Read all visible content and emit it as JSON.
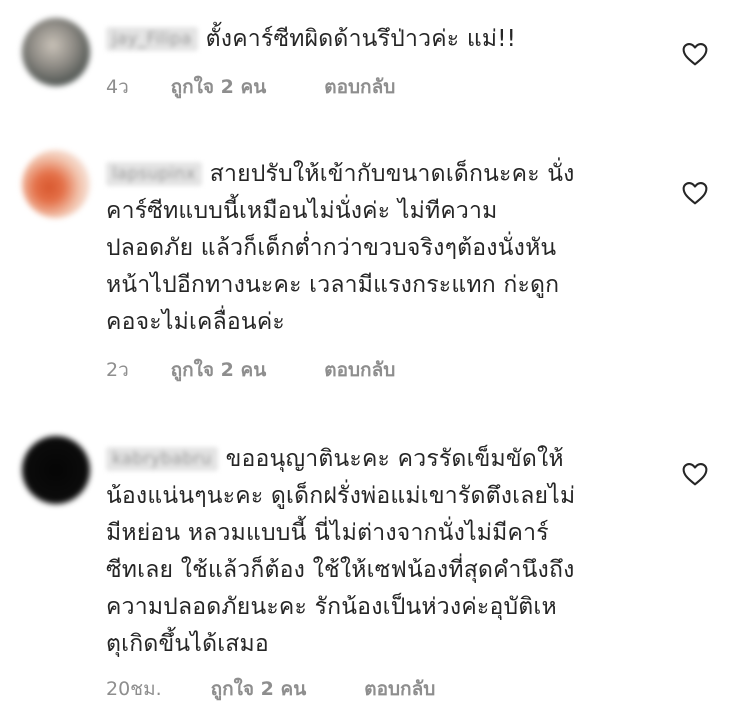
{
  "comments": [
    {
      "username": "jay_Filipa",
      "text": "ตั้งคาร์ซีทผิดด้านรึป่าวค่ะ แม่!!",
      "time": "4ว",
      "likes": "ถูกใจ 2 คน",
      "reply": "ตอบกลับ"
    },
    {
      "username": "lapsupinx",
      "text": "สายปรับให้เข้ากับขนาดเด็กนะคะ นั่ง\nคาร์ซีทแบบนี้เหมือนไม่นั่งค่ะ ไม่ทีความ\nปลอดภัย แล้วก็เด็กต่ำกว่าขวบจริงๆต้องนั่งหัน\nหน้าไปอีกทางนะคะ เวลามีแรงกระแทก ก่ะดูก\nคอจะไม่เคลื่อนค่ะ",
      "time": "2ว",
      "likes": "ถูกใจ 2 คน",
      "reply": "ตอบกลับ"
    },
    {
      "username": "kabrybabru",
      "text": "ขออนุญาตินะคะ ควรรัดเข็มขัดให้\nน้องแน่นๆนะคะ ดูเด็กฝรั่งพ่อแม่เขารัดตึงเลยไม่\nมีหย่อน หลวมแบบนี้ นี่ไม่ต่างจากนั่งไม่มีคาร์\nซีทเลย ใช้แล้วก็ต้อง ใช้ให้เซฟน้องที่สุดคำนึงถึง\nความปลอดภัยนะคะ รักน้องเป็นห่วงค่ะอุบัติเห\nตุเกิดขึ้นได้เสมอ",
      "time": "20ชม.",
      "likes": "ถูกใจ 2 คน",
      "reply": "ตอบกลับ"
    }
  ],
  "icons": {
    "like": "heart-outline-icon",
    "color": "#262626"
  }
}
